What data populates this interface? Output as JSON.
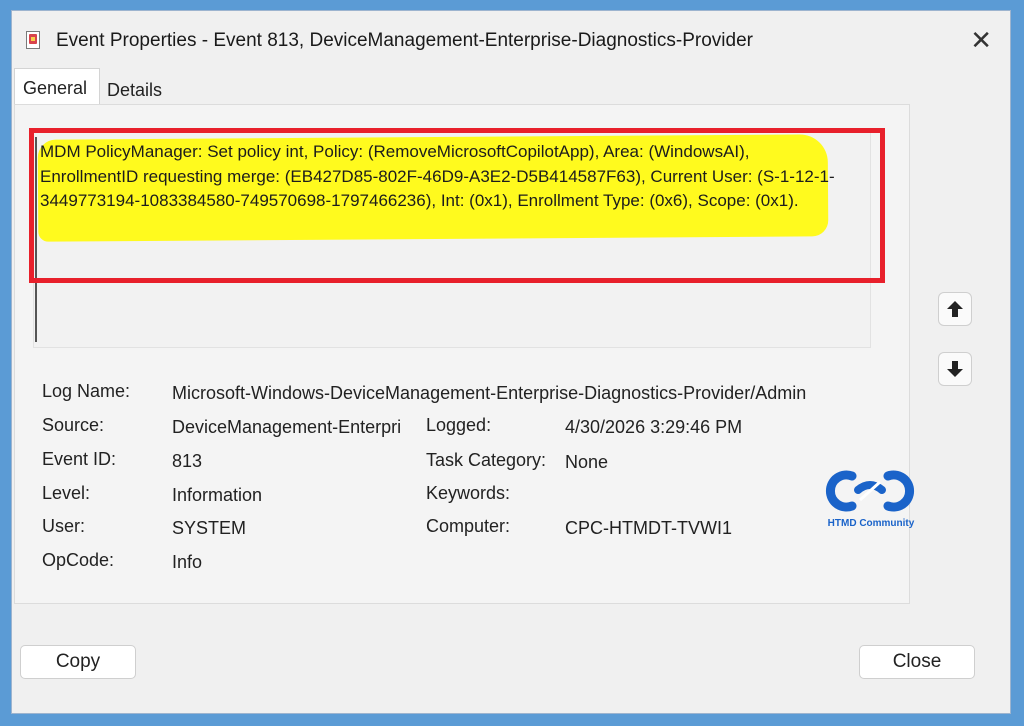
{
  "window": {
    "title": "Event Properties - Event 813, DeviceManagement-Enterprise-Diagnostics-Provider",
    "close_glyph": "✕"
  },
  "tabs": {
    "general": "General",
    "details": "Details"
  },
  "description": "MDM PolicyManager: Set policy int, Policy: (RemoveMicrosoftCopilotApp), Area: (WindowsAI), EnrollmentID requesting merge: (EB427D85-802F-46D9-A3E2-D5B414587F63), Current User: (S-1-12-1-3449773194-1083384580-749570698-1797466236), Int: (0x1), Enrollment Type: (0x6), Scope: (0x1).",
  "fields": {
    "log_name_label": "Log Name:",
    "log_name_value": "Microsoft-Windows-DeviceManagement-Enterprise-Diagnostics-Provider/Admin",
    "source_label": "Source:",
    "source_value": "DeviceManagement-Enterpri",
    "logged_label": "Logged:",
    "logged_value": "4/30/2026 3:29:46 PM",
    "event_id_label": "Event ID:",
    "event_id_value": "813",
    "task_category_label": "Task Category:",
    "task_category_value": "None",
    "level_label": "Level:",
    "level_value": "Information",
    "keywords_label": "Keywords:",
    "keywords_value": "",
    "user_label": "User:",
    "user_value": "SYSTEM",
    "computer_label": "Computer:",
    "computer_value": "CPC-HTMDT-TVWI1",
    "opcode_label": "OpCode:",
    "opcode_value": "Info"
  },
  "watermark": {
    "text": "HTMD Community"
  },
  "buttons": {
    "copy": "Copy",
    "close": "Close"
  },
  "colors": {
    "accent_border": "#5b9bd5",
    "highlight": "#fffa1e",
    "annotation_red": "#e8202b",
    "logo_blue": "#1a63c9"
  }
}
